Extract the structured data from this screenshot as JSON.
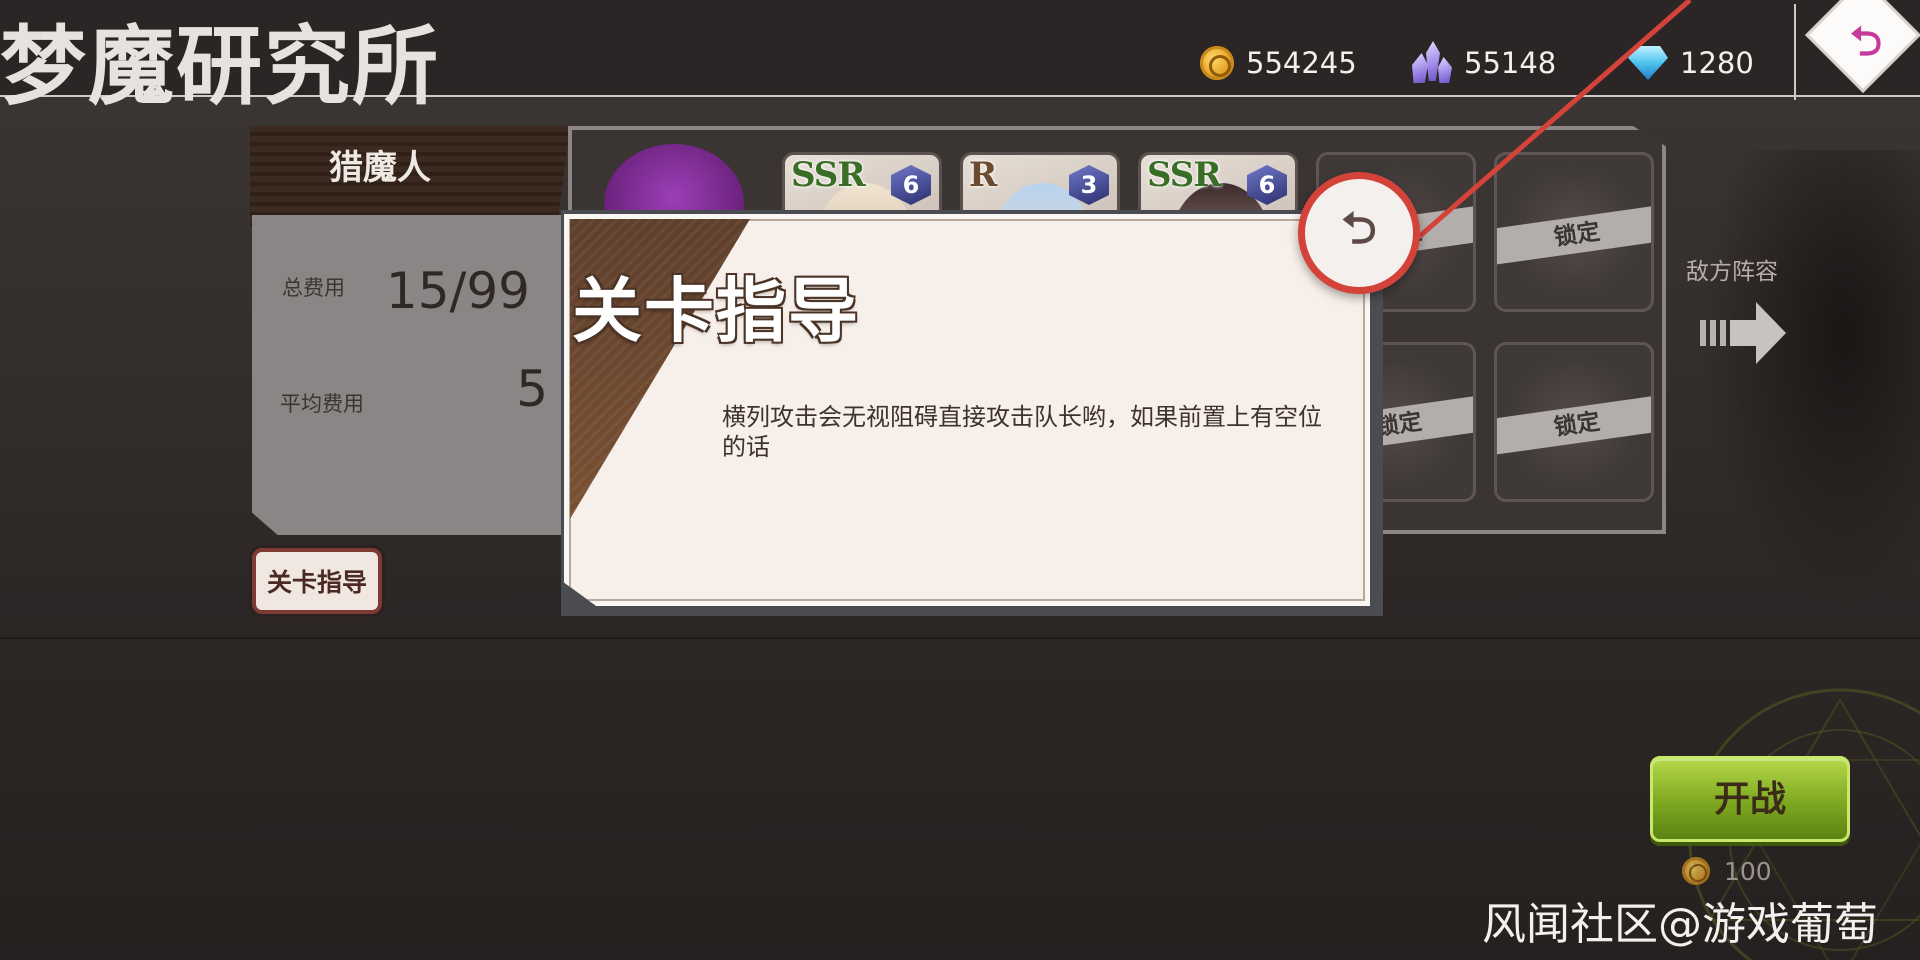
{
  "header": {
    "title": "梦魔研究所",
    "currencies": [
      {
        "icon": "coin-icon",
        "value": "554245"
      },
      {
        "icon": "crystal-icon",
        "value": "55148"
      },
      {
        "icon": "gem-icon",
        "value": "1280"
      }
    ]
  },
  "team": {
    "name": "猎魔人",
    "total_cost_label": "总费用",
    "total_cost_value": "15/99",
    "avg_cost_label": "平均费用",
    "avg_cost_value": "5",
    "guide_button": "关卡指导"
  },
  "formation": {
    "cards": [
      {
        "rank": "SSR",
        "level": "6"
      },
      {
        "rank": "R",
        "level": "3"
      },
      {
        "rank": "SSR",
        "level": "6"
      }
    ],
    "locked_label": "锁定",
    "enemy_label": "敌方阵容"
  },
  "modal": {
    "title": "关卡指导",
    "body": "横列攻击会无视阻碍直接攻击队长哟，如果前置上有空位的话"
  },
  "battle": {
    "button": "开战",
    "cost": "100"
  },
  "watermark": "风闻社区@游戏葡萄",
  "colors": {
    "accent_red": "#d3433a",
    "battle_green": "#7ea820",
    "modal_bg": "#f7efe9"
  }
}
